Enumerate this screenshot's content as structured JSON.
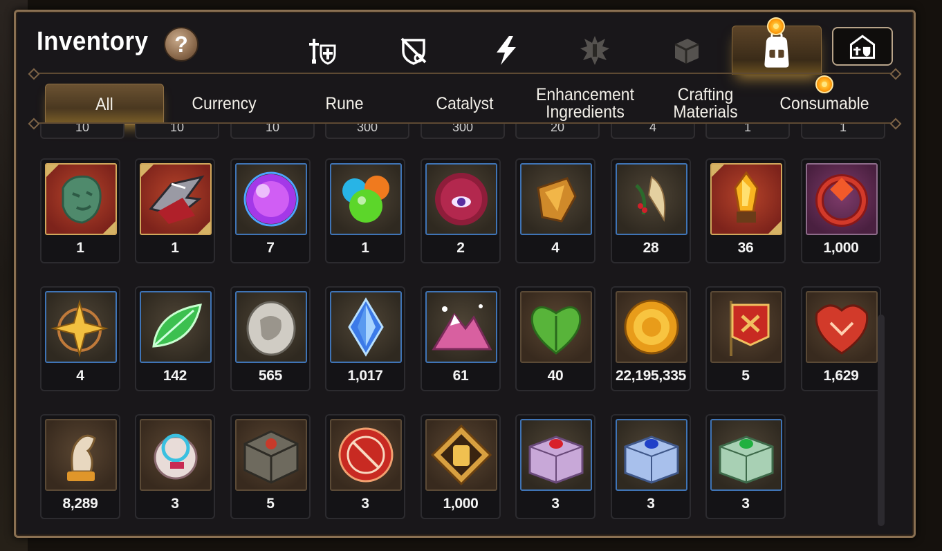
{
  "header": {
    "title": "Inventory",
    "help_label": "?"
  },
  "top_tabs": [
    {
      "name": "equipment-tab-icon",
      "active": false
    },
    {
      "name": "artifact-tab-icon",
      "active": false
    },
    {
      "name": "skill-tab-icon",
      "active": false
    },
    {
      "name": "special-tab-icon",
      "active": false
    },
    {
      "name": "box-tab-icon",
      "active": false
    },
    {
      "name": "backpack-tab-icon",
      "active": true
    }
  ],
  "category_tabs": [
    {
      "label": "All",
      "active": true
    },
    {
      "label": "Currency"
    },
    {
      "label": "Rune"
    },
    {
      "label": "Catalyst"
    },
    {
      "label": "Enhancement Ingredients"
    },
    {
      "label": "Crafting Materials"
    },
    {
      "label": "Consumable",
      "badge": true
    }
  ],
  "partial_row": [
    "10",
    "10",
    "10",
    "300",
    "300",
    "20",
    "4",
    "1",
    "1"
  ],
  "items": [
    {
      "name": "stone-mask-icon",
      "frame": "red",
      "qty": "1"
    },
    {
      "name": "dark-claw-icon",
      "frame": "red",
      "qty": "1"
    },
    {
      "name": "purple-orb-icon",
      "frame": "blue",
      "qty": "7"
    },
    {
      "name": "color-orbs-icon",
      "frame": "blue",
      "qty": "1"
    },
    {
      "name": "eye-orb-icon",
      "frame": "blue",
      "qty": "2"
    },
    {
      "name": "amber-shard-icon",
      "frame": "blue",
      "qty": "4"
    },
    {
      "name": "feather-herb-icon",
      "frame": "blue",
      "qty": "28"
    },
    {
      "name": "fire-crystal-icon",
      "frame": "red",
      "qty": "36"
    },
    {
      "name": "red-ring-icon",
      "frame": "purple",
      "qty": "1,000"
    },
    {
      "name": "star-amulet-icon",
      "frame": "blue",
      "qty": "4"
    },
    {
      "name": "green-leaf-icon",
      "frame": "blue",
      "qty": "142"
    },
    {
      "name": "silver-coin-icon",
      "frame": "blue",
      "qty": "565"
    },
    {
      "name": "blue-crystal-icon",
      "frame": "blue",
      "qty": "1,017"
    },
    {
      "name": "pink-mountain-icon",
      "frame": "blue",
      "qty": "61"
    },
    {
      "name": "green-heart-icon",
      "frame": "brown",
      "qty": "40"
    },
    {
      "name": "gold-coin-icon",
      "frame": "brown",
      "qty": "22,195,335"
    },
    {
      "name": "banner-icon",
      "frame": "brown",
      "qty": "5"
    },
    {
      "name": "red-leaf-icon",
      "frame": "brown",
      "qty": "1,629"
    },
    {
      "name": "horse-trophy-icon",
      "frame": "brown",
      "qty": "8,289"
    },
    {
      "name": "gear-orb-icon",
      "frame": "brown",
      "qty": "3"
    },
    {
      "name": "stone-cube-icon",
      "frame": "brown",
      "qty": "5"
    },
    {
      "name": "red-seal-icon",
      "frame": "brown",
      "qty": "3"
    },
    {
      "name": "fist-emblem-icon",
      "frame": "brown",
      "qty": "1,000"
    },
    {
      "name": "pink-chest-icon",
      "frame": "blue",
      "qty": "3"
    },
    {
      "name": "blue-chest-icon",
      "frame": "blue",
      "qty": "3"
    },
    {
      "name": "green-chest-icon",
      "frame": "blue",
      "qty": "3"
    }
  ]
}
